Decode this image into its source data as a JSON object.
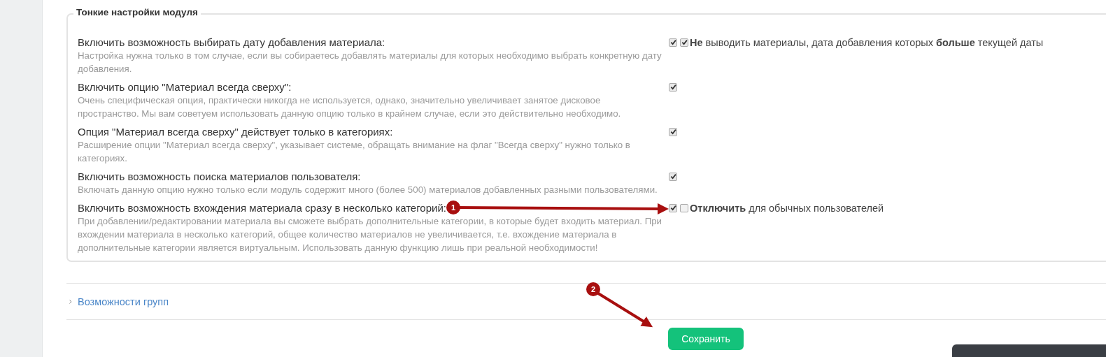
{
  "fieldset": {
    "legend": "Тонкие настройки модуля",
    "settings": [
      {
        "label": "Включить возможность выбирать дату добавления материала:",
        "hint": "Настройка нужна только в том случае, если вы собираетесь добавлять материалы для которых необходимо выбрать конкретную дату добавления.",
        "checked": true,
        "extra": {
          "checked": true,
          "text": "**Не** выводить материалы, дата добавления которых **больше** текущей даты"
        }
      },
      {
        "label": "Включить опцию \"Материал всегда сверху\":",
        "hint": "Очень специфическая опция, практически никогда не используется, однако, значительно увеличивает занятое дисковое пространство. Мы вам советуем использовать данную опцию только в крайнем случае, если это действительно необходимо.",
        "checked": true
      },
      {
        "label": "Опция \"Материал всегда сверху\" действует только в категориях:",
        "hint": "Расширение опции \"Материал всегда сверху\", указывает системе, обращать внимание на флаг \"Всегда сверху\" нужно только в категориях.",
        "checked": true
      },
      {
        "label": "Включить возможность поиска материалов пользователя:",
        "hint": "Включать данную опцию нужно только если модуль содержит много (более 500) материалов добавленных разными пользователями.",
        "checked": true
      },
      {
        "label": "Включить возможность вхождения материала сразу в несколько категорий:",
        "hint": "При добавлении/редактировании материала вы сможете выбрать дополнительные категории, в которые будет входить материал. При вхождении материала в несколько категорий, общее количество материалов не увеличивается, т.е. вхождение материала в дополнительные категории является виртуальным. Использовать данную функцию лишь при реальной необходимости!",
        "checked": true,
        "extra": {
          "checked": false,
          "text": "**Отключить** для обычных пользователей"
        }
      }
    ]
  },
  "section_link": {
    "label": "Возможности групп",
    "expanded": false
  },
  "save_button": "Сохранить",
  "annotations": [
    {
      "number": "1"
    },
    {
      "number": "2"
    }
  ]
}
